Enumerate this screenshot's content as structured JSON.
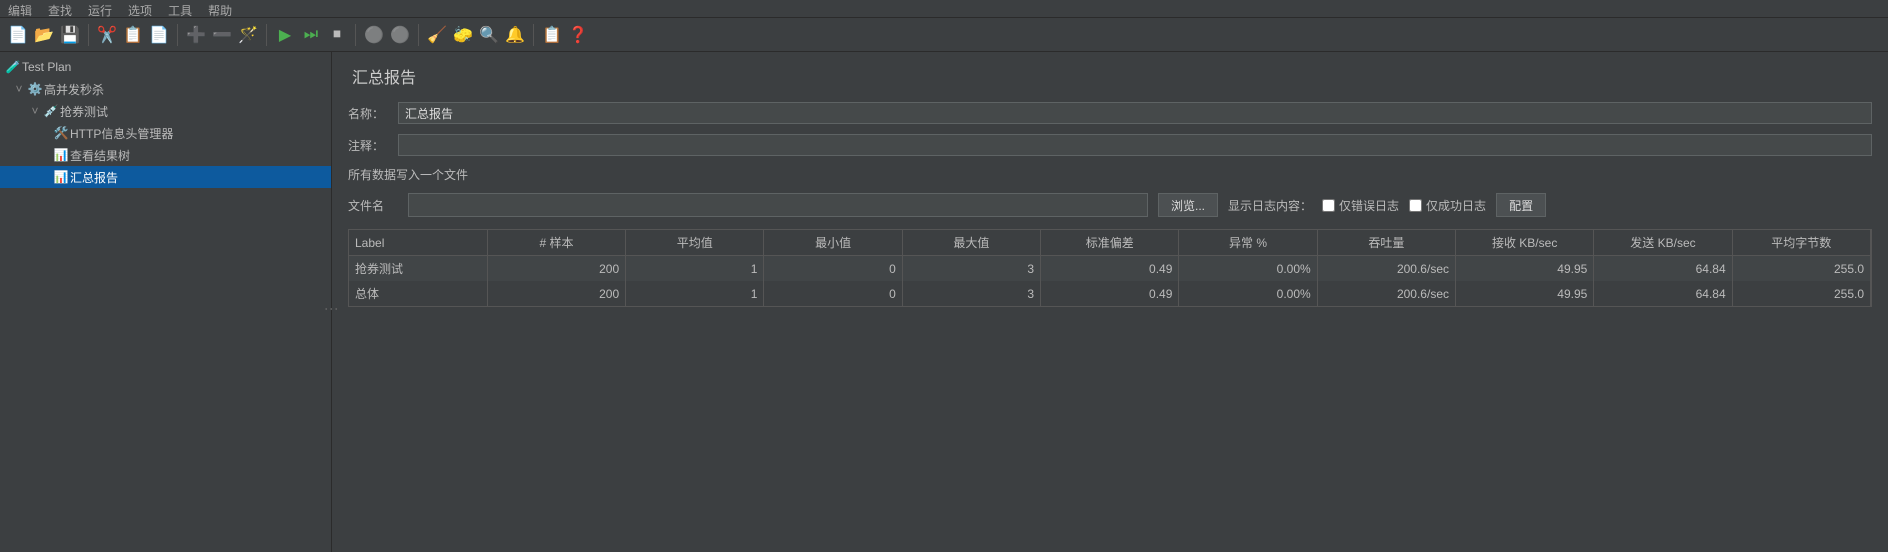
{
  "menu": {
    "items": [
      "编辑",
      "查找",
      "运行",
      "选项",
      "工具",
      "帮助"
    ]
  },
  "toolbar": {
    "new": "📄",
    "open": "📂",
    "save": "💾",
    "cut": "✂️",
    "copy": "📋",
    "paste": "📄",
    "plus": "➕",
    "minus": "➖",
    "wand": "🪄",
    "run": "▶",
    "runnext": "⏭",
    "stop": "⏹",
    "stop1": "⚪",
    "stop2": "⚪",
    "clean": "🧹",
    "broom": "🧽",
    "find": "🔍",
    "bell": "🔔",
    "report": "📋",
    "help": "❓"
  },
  "tree": {
    "root": "Test Plan",
    "group": "高并发秒杀",
    "thread": "抢券测试",
    "header": "HTTP信息头管理器",
    "results": "查看结果树",
    "summary": "汇总报告"
  },
  "panel": {
    "title": "汇总报告",
    "name_label": "名称：",
    "name_value": "汇总报告",
    "comment_label": "注释：",
    "comment_value": "",
    "file_section": "所有数据写入一个文件",
    "file_label": "文件名",
    "browse": "浏览...",
    "log_label": "显示日志内容：",
    "error_only": "仅错误日志",
    "success_only": "仅成功日志",
    "config": "配置"
  },
  "table": {
    "headers": [
      "Label",
      "# 样本",
      "平均值",
      "最小值",
      "最大值",
      "标准偏差",
      "异常 %",
      "吞吐量",
      "接收 KB/sec",
      "发送 KB/sec",
      "平均字节数"
    ],
    "rows": [
      {
        "label": "抢券测试",
        "samples": "200",
        "avg": "1",
        "min": "0",
        "max": "3",
        "stddev": "0.49",
        "error": "0.00%",
        "throughput": "200.6/sec",
        "recv": "49.95",
        "sent": "64.84",
        "bytes": "255.0"
      },
      {
        "label": "总体",
        "samples": "200",
        "avg": "1",
        "min": "0",
        "max": "3",
        "stddev": "0.49",
        "error": "0.00%",
        "throughput": "200.6/sec",
        "recv": "49.95",
        "sent": "64.84",
        "bytes": "255.0"
      }
    ]
  }
}
